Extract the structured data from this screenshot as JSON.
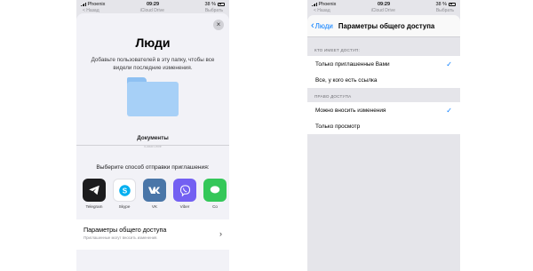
{
  "left": {
    "status": {
      "carrier": "Phoenix",
      "time": "09:29",
      "battery": "38 %"
    },
    "background_peek": {
      "left": "< Назад",
      "center": "iCloud Drive",
      "right": "Выбрать"
    },
    "sheet": {
      "close_label": "×",
      "title": "Люди",
      "subtitle": "Добавьте пользователей в эту папку, чтобы все видели последние изменения.",
      "folder_name": "Документы",
      "folder_meta": "iCloud Drive",
      "share_caption": "Выберите способ отправки приглашения:",
      "apps": [
        {
          "label": "Telegram",
          "icon": "telegram-icon",
          "color": "#1c1c1e"
        },
        {
          "label": "Skype",
          "icon": "skype-icon",
          "color": "#ffffff"
        },
        {
          "label": "VK",
          "icon": "vk-icon",
          "color": "#4a76a8"
        },
        {
          "label": "Viber",
          "icon": "viber-icon",
          "color": "#7360f2"
        },
        {
          "label": "Co",
          "icon": "messages-icon",
          "color": "#34c759"
        }
      ],
      "share_options": {
        "title": "Параметры общего доступа",
        "subtitle": "Приглашенные могут вносить изменения."
      }
    }
  },
  "right": {
    "status": {
      "carrier": "Phoenix",
      "time": "09:29",
      "battery": "38 %"
    },
    "background_peek": {
      "left": "< Назад",
      "center": "iCloud Drive",
      "right": "Выбрать"
    },
    "nav": {
      "back_label": "Люди",
      "title": "Параметры общего доступа"
    },
    "sections": [
      {
        "header": "КТО ИМЕЕТ ДОСТУП:",
        "rows": [
          {
            "label": "Только приглашенные Вами",
            "checked": true
          },
          {
            "label": "Все, у кого есть ссылка",
            "checked": false
          }
        ]
      },
      {
        "header": "ПРАВО ДОСТУПА",
        "rows": [
          {
            "label": "Можно вносить изменения",
            "checked": true
          },
          {
            "label": "Только просмотр",
            "checked": false
          }
        ]
      }
    ],
    "check_glyph": "✓",
    "accent": "#007aff"
  }
}
